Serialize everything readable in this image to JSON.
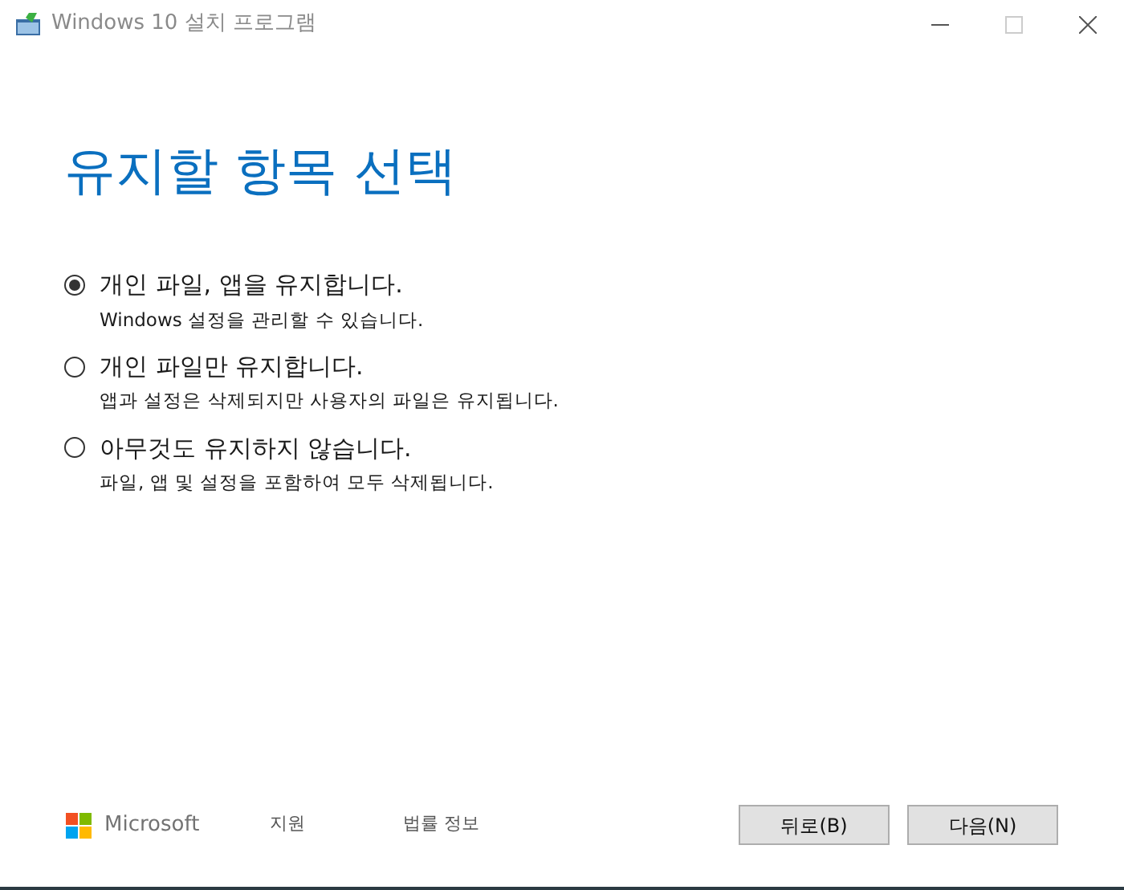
{
  "window": {
    "title": "Windows 10 설치 프로그램"
  },
  "heading": "유지할 항목 선택",
  "options": [
    {
      "label": "개인 파일, 앱을 유지합니다.",
      "description": "Windows 설정을 관리할 수 있습니다.",
      "selected": true
    },
    {
      "label": "개인 파일만 유지합니다.",
      "description": "앱과 설정은 삭제되지만 사용자의 파일은 유지됩니다.",
      "selected": false
    },
    {
      "label": "아무것도 유지하지 않습니다.",
      "description": "파일, 앱 및 설정을 포함하여 모두 삭제됩니다.",
      "selected": false
    }
  ],
  "footer": {
    "brand": "Microsoft",
    "links": [
      "지원",
      "법률 정보"
    ],
    "buttons": [
      "뒤로(B)",
      "다음(N)"
    ]
  }
}
